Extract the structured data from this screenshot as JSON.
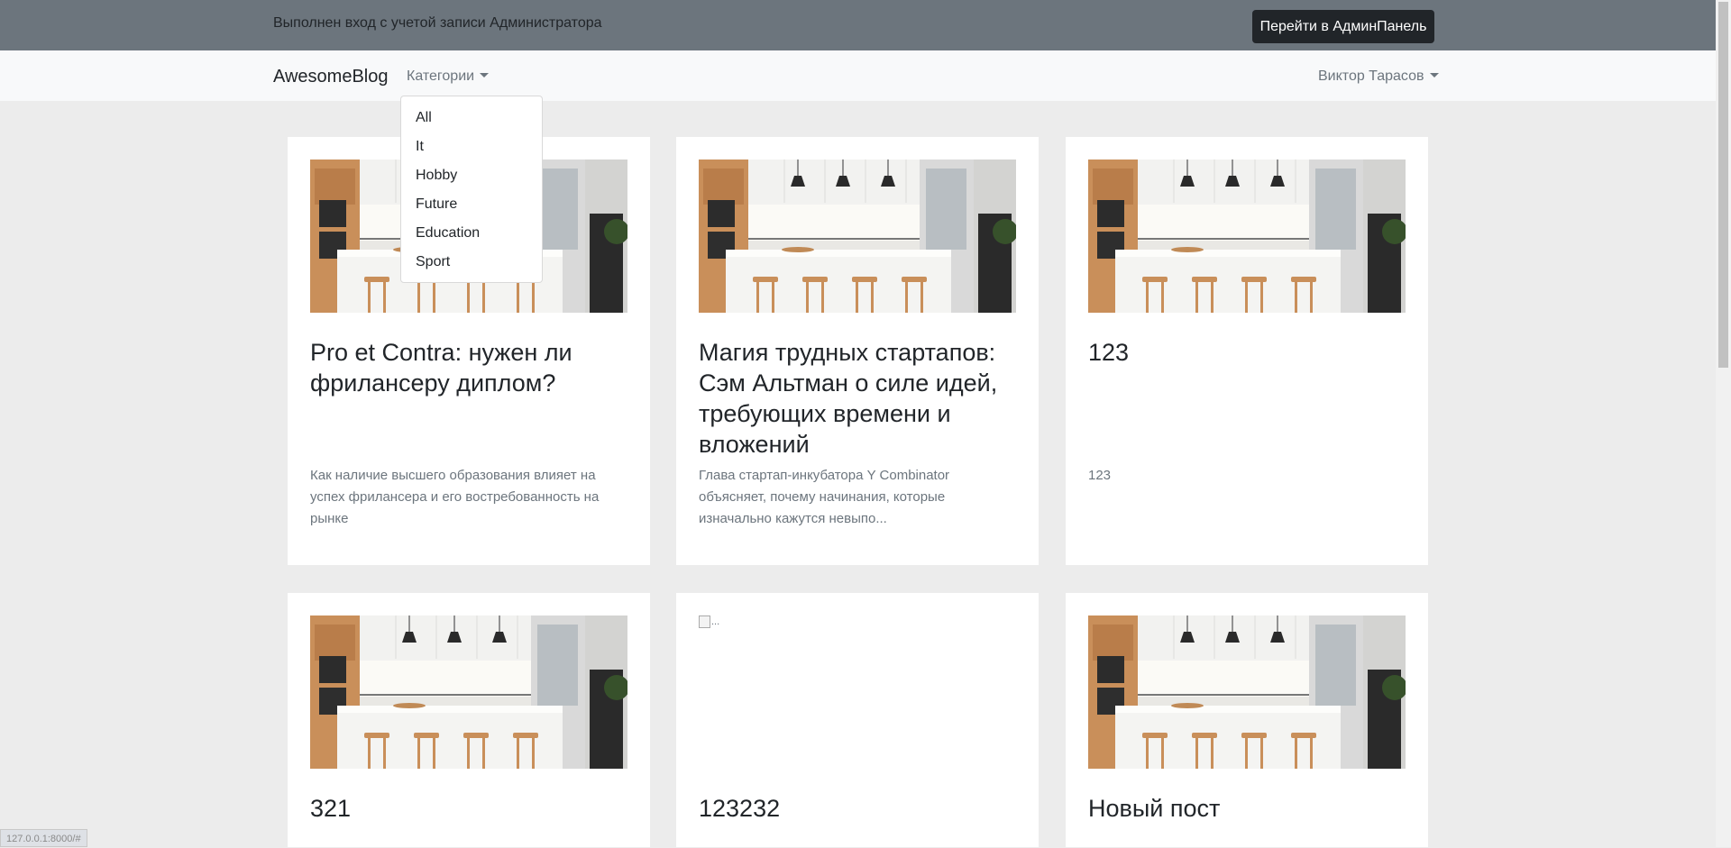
{
  "admin_bar": {
    "text": "Выполнен вход с учетой записи Администратора",
    "button_label": "Перейти в АдминПанель"
  },
  "navbar": {
    "brand": "AwesomeBlog",
    "categories_label": "Категории",
    "user_label": "Виктор Тарасов"
  },
  "categories_menu": [
    "All",
    "It",
    "Hobby",
    "Future",
    "Education",
    "Sport"
  ],
  "posts": [
    {
      "title": "Pro et Contra: нужен ли фрилансеру диплом?",
      "excerpt": "Как наличие высшего образования влияет на успех фрилансера и его востребованность на рынке",
      "image": "kitchen"
    },
    {
      "title": "Магия трудных стартапов: Сэм Альтман о силе идей, требующих времени и вложений",
      "excerpt": "Глава стартап-инкубатора Y Combinator объясняет, почему начинания, которые изначально кажутся невыпо...",
      "image": "kitchen"
    },
    {
      "title": "123",
      "excerpt": "123",
      "image": "kitchen"
    },
    {
      "title": "321",
      "excerpt": "",
      "image": "kitchen"
    },
    {
      "title": "123232",
      "excerpt": "",
      "image": "broken",
      "image_alt": "..."
    },
    {
      "title": "Новый пост",
      "excerpt": "",
      "image": "kitchen"
    }
  ],
  "status_url": "127.0.0.1:8000/#",
  "colors": {
    "admin_bar_bg": "#6c757d",
    "admin_button_bg": "#212529",
    "navbar_bg": "#f8f9fa",
    "page_bg": "#ececec",
    "muted_text": "#6c757d"
  },
  "icons": [
    "caret-down-icon",
    "broken-image-icon"
  ]
}
